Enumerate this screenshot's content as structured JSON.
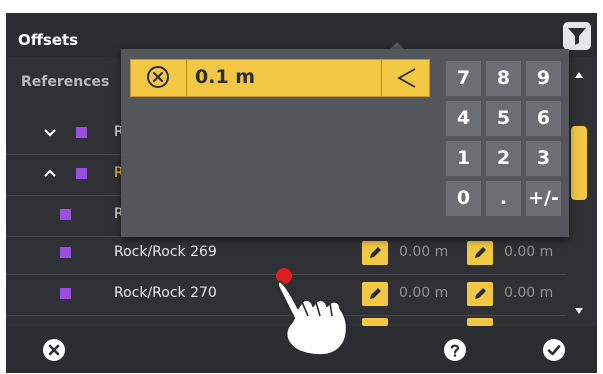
{
  "header": {
    "title": "Offsets"
  },
  "subheader": {
    "label": "References"
  },
  "rows": [
    {
      "name": "R"
    },
    {
      "name": "R"
    },
    {
      "name": "R"
    },
    {
      "name": "Rock/Rock 269",
      "value1": "0.00 m",
      "value2": "0.00 m"
    },
    {
      "name": "Rock/Rock 270",
      "value1": "0.00 m",
      "value2": "0.00 m"
    }
  ],
  "keypad": {
    "input_value": "0.1 m",
    "keys": [
      "7",
      "8",
      "9",
      "4",
      "5",
      "6",
      "1",
      "2",
      "3",
      "0",
      ".",
      "+/-"
    ]
  },
  "colors": {
    "accent": "#f2c744",
    "marker": "#9b4fe0",
    "background": "#2f3134"
  },
  "icons": [
    "filter-icon",
    "clear-icon",
    "backspace-icon",
    "chevron-down-icon",
    "chevron-up-icon",
    "pencil-icon",
    "close-icon",
    "help-icon",
    "check-icon",
    "scroll-up-icon",
    "scroll-down-icon",
    "hand-pointer-icon"
  ]
}
